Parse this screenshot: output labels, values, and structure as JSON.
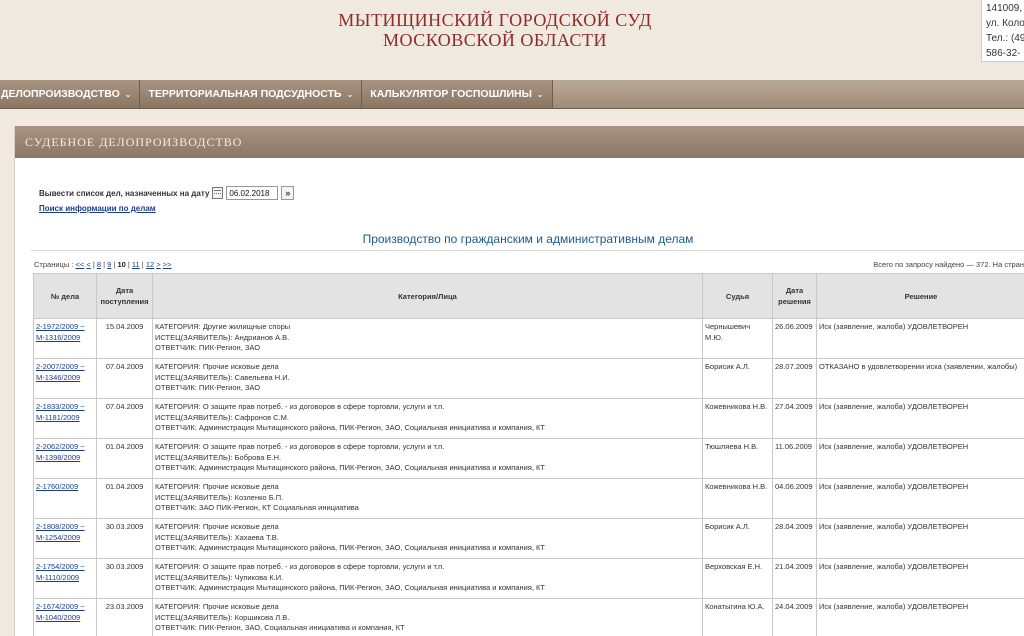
{
  "header": {
    "court_title_line1": "МЫТИЩИНСКИЙ ГОРОДСКОЙ СУД",
    "court_title_line2": "МОСКОВСКОЙ ОБЛАСТИ",
    "contact_lines": [
      "141009,",
      "ул. Коло",
      "Тел.: (49",
      "586-32-"
    ]
  },
  "nav": {
    "items": [
      {
        "label": "ДЕЛОПРОИЗВОДСТВО"
      },
      {
        "label": "ТЕРРИТОРИАЛЬНАЯ ПОДСУДНОСТЬ"
      },
      {
        "label": "КАЛЬКУЛЯТОР ГОСПОШЛИНЫ"
      }
    ]
  },
  "panel": {
    "title": "СУДЕБНОЕ ДЕЛОПРОИЗВОДСТВО",
    "date_label": "Вывести список дел, назначенных на дату",
    "date_value": "06.02.2018",
    "search_link": "Поиск информации по делам",
    "section_title": "Производство по гражданским и административным делам",
    "pages_label": "Страницы :",
    "pages": [
      "<<",
      "<",
      "8",
      "9",
      "10",
      "11",
      "12",
      ">",
      ">>"
    ],
    "current_page": "10",
    "found_text": "Всего по запросу найдено — 372. На стран"
  },
  "table": {
    "headers": [
      "№ дела",
      "Дата поступления",
      "Категория/Лица",
      "Судья",
      "Дата решения",
      "Решение"
    ],
    "rows": [
      {
        "num": [
          "2-1972/2009 ~",
          "М-1316/2009"
        ],
        "date_in": "15.04.2009",
        "parties": [
          "КАТЕГОРИЯ: Другие жилищные споры",
          "ИСТЕЦ(ЗАЯВИТЕЛЬ): Андрианов А.В.",
          "ОТВЕТЧИК: ПИК-Регион, ЗАО"
        ],
        "judge": "Чернышевич М.Ю.",
        "date_dec": "26.06.2009",
        "decision": "Иск (заявление, жалоба) УДОВЛЕТВОРЕН"
      },
      {
        "num": [
          "2-2007/2009 ~",
          "М-1346/2009"
        ],
        "date_in": "07.04.2009",
        "parties": [
          "КАТЕГОРИЯ: Прочие исковые дела",
          "ИСТЕЦ(ЗАЯВИТЕЛЬ): Савельева Н.И.",
          "ОТВЕТЧИК: ПИК-Регион, ЗАО"
        ],
        "judge": "Борисик А.Л.",
        "date_dec": "28.07.2009",
        "decision": "ОТКАЗАНО в удовлетворении иска (заявлении, жалобы)"
      },
      {
        "num": [
          "2-1833/2009 ~",
          "М-1181/2009"
        ],
        "date_in": "07.04.2009",
        "parties": [
          "КАТЕГОРИЯ: О защите прав потреб. - из договоров в сфере торговли, услуги и т.п.",
          "ИСТЕЦ(ЗАЯВИТЕЛЬ): Сафронов С.М.",
          "ОТВЕТЧИК: Администрация Мытищинского района, ПИК-Регион, ЗАО, Социальная инициатива и компания, КТ"
        ],
        "judge": "Кожевникова Н.В.",
        "date_dec": "27.04.2009",
        "decision": "Иск (заявление, жалоба) УДОВЛЕТВОРЕН"
      },
      {
        "num": [
          "2-2062/2009 ~",
          "М-1398/2009"
        ],
        "date_in": "01.04.2009",
        "parties": [
          "КАТЕГОРИЯ: О защите прав потреб. - из договоров в сфере торговли, услуги и т.п.",
          "ИСТЕЦ(ЗАЯВИТЕЛЬ): Боброва Е.Н.",
          "ОТВЕТЧИК: Администрация Мытищинского района, ПИК-Регион, ЗАО, Социальная инициатива и компания, КТ"
        ],
        "judge": "Тюшляева Н.В.",
        "date_dec": "11.06.2009",
        "decision": "Иск (заявление, жалоба) УДОВЛЕТВОРЕН"
      },
      {
        "num": [
          "2-1760/2009",
          ""
        ],
        "date_in": "01.04.2009",
        "parties": [
          "КАТЕГОРИЯ: Прочие исковые дела",
          "ИСТЕЦ(ЗАЯВИТЕЛЬ): Козленко Б.П.",
          "ОТВЕТЧИК: ЗАО ПИК-Регион, КТ Социальная инициатива"
        ],
        "judge": "Кожевникова Н.В.",
        "date_dec": "04.06.2009",
        "decision": "Иск (заявление, жалоба) УДОВЛЕТВОРЕН"
      },
      {
        "num": [
          "2-1808/2009 ~",
          "М-1254/2009"
        ],
        "date_in": "30.03.2009",
        "parties": [
          "КАТЕГОРИЯ: Прочие исковые дела",
          "ИСТЕЦ(ЗАЯВИТЕЛЬ): Хахаева Т.В.",
          "ОТВЕТЧИК: Администрация Мытищинского района, ПИК-Регион, ЗАО, Социальная инициатива и компания, КТ"
        ],
        "judge": "Борисик А.Л.",
        "date_dec": "28.04.2009",
        "decision": "Иск (заявление, жалоба) УДОВЛЕТВОРЕН"
      },
      {
        "num": [
          "2-1754/2009 ~",
          "М-1110/2009"
        ],
        "date_in": "30.03.2009",
        "parties": [
          "КАТЕГОРИЯ: О защите прав потреб. - из договоров в сфере торговли, услуги и т.п.",
          "ИСТЕЦ(ЗАЯВИТЕЛЬ): Чупикова К.И.",
          "ОТВЕТЧИК: Администрация Мытищинского района, ПИК-Регион, ЗАО, Социальная инициатива и компания, КТ"
        ],
        "judge": "Верховская Е.Н.",
        "date_dec": "21.04.2009",
        "decision": "Иск (заявление, жалоба) УДОВЛЕТВОРЕН"
      },
      {
        "num": [
          "2-1674/2009 ~",
          "М-1040/2009"
        ],
        "date_in": "23.03.2009",
        "parties": [
          "КАТЕГОРИЯ: Прочие исковые дела",
          "ИСТЕЦ(ЗАЯВИТЕЛЬ): Коршикова Л.В.",
          "ОТВЕТЧИК: ПИК-Регион, ЗАО, Социальная инициатива и компания, КТ"
        ],
        "judge": "Конатыгина Ю.А.",
        "date_dec": "24.04.2009",
        "decision": "Иск (заявление, жалоба) УДОВЛЕТВОРЕН"
      }
    ]
  }
}
